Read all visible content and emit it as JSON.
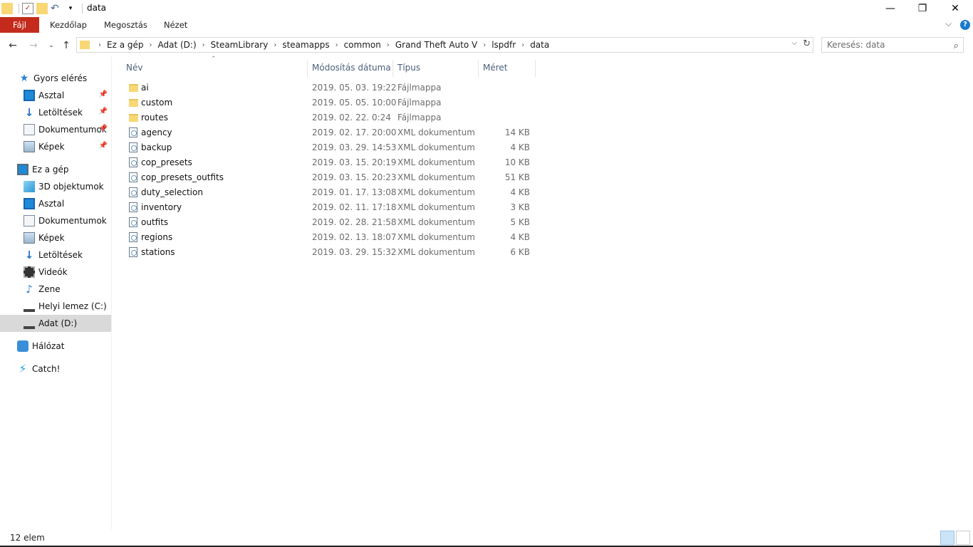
{
  "window": {
    "title": "data",
    "minimize": "—",
    "restore": "❐",
    "close": "✕"
  },
  "ribbon": {
    "tabs": [
      "Fájl",
      "Kezdőlap",
      "Megosztás",
      "Nézet"
    ],
    "expand": "⌵",
    "help": "?"
  },
  "address": {
    "crumbs": [
      "Ez a gép",
      "Adat (D:)",
      "SteamLibrary",
      "steamapps",
      "common",
      "Grand Theft Auto V",
      "lspdfr",
      "data"
    ],
    "search_placeholder": "Keresés: data"
  },
  "nav": {
    "quick_access": "Gyors elérés",
    "quick_items": [
      "Asztal",
      "Letöltések",
      "Dokumentumok",
      "Képek"
    ],
    "this_pc": "Ez a gép",
    "pc_items": [
      "3D objektumok",
      "Asztal",
      "Dokumentumok",
      "Képek",
      "Letöltések",
      "Videók",
      "Zene",
      "Helyi lemez (C:)",
      "Adat (D:)"
    ],
    "network": "Hálózat",
    "catch": "Catch!"
  },
  "columns": {
    "name": "Név",
    "date": "Módosítás dátuma",
    "type": "Típus",
    "size": "Méret"
  },
  "files": [
    {
      "name": "ai",
      "date": "2019. 05. 03. 19:22",
      "type": "Fájlmappa",
      "size": "",
      "kind": "folder"
    },
    {
      "name": "custom",
      "date": "2019. 05. 05. 10:00",
      "type": "Fájlmappa",
      "size": "",
      "kind": "folder"
    },
    {
      "name": "routes",
      "date": "2019. 02. 22. 0:24",
      "type": "Fájlmappa",
      "size": "",
      "kind": "folder"
    },
    {
      "name": "agency",
      "date": "2019. 02. 17. 20:00",
      "type": "XML dokumentum",
      "size": "14 KB",
      "kind": "xml"
    },
    {
      "name": "backup",
      "date": "2019. 03. 29. 14:53",
      "type": "XML dokumentum",
      "size": "4 KB",
      "kind": "xml"
    },
    {
      "name": "cop_presets",
      "date": "2019. 03. 15. 20:19",
      "type": "XML dokumentum",
      "size": "10 KB",
      "kind": "xml"
    },
    {
      "name": "cop_presets_outfits",
      "date": "2019. 03. 15. 20:23",
      "type": "XML dokumentum",
      "size": "51 KB",
      "kind": "xml"
    },
    {
      "name": "duty_selection",
      "date": "2019. 01. 17. 13:08",
      "type": "XML dokumentum",
      "size": "4 KB",
      "kind": "xml"
    },
    {
      "name": "inventory",
      "date": "2019. 02. 11. 17:18",
      "type": "XML dokumentum",
      "size": "3 KB",
      "kind": "xml"
    },
    {
      "name": "outfits",
      "date": "2019. 02. 28. 21:58",
      "type": "XML dokumentum",
      "size": "5 KB",
      "kind": "xml"
    },
    {
      "name": "regions",
      "date": "2019. 02. 13. 18:07",
      "type": "XML dokumentum",
      "size": "4 KB",
      "kind": "xml"
    },
    {
      "name": "stations",
      "date": "2019. 03. 29. 15:32",
      "type": "XML dokumentum",
      "size": "6 KB",
      "kind": "xml"
    }
  ],
  "status": {
    "count": "12 elem"
  }
}
